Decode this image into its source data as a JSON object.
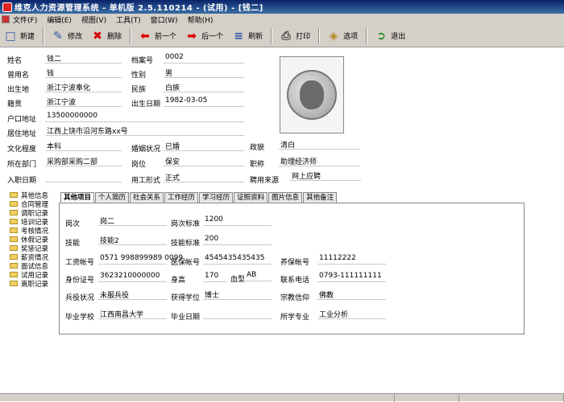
{
  "window": {
    "title": "维克人力资源管理系统 - 单机版 2.5.110214 - (试用) - [钱二]"
  },
  "menu": [
    "文件(F)",
    "编辑(E)",
    "视图(V)",
    "工具(T)",
    "窗口(W)",
    "帮助(H)"
  ],
  "toolbar": {
    "new": "新建",
    "edit": "修改",
    "delete": "删除",
    "prev": "前一个",
    "next": "后一个",
    "refresh": "刷新",
    "print": "打印",
    "options": "选项",
    "exit": "退出"
  },
  "form": {
    "name_l": "姓名",
    "name": "钱二",
    "fileno_l": "档案号",
    "fileno": "0002",
    "usedname_l": "曾用名",
    "usedname": "钱",
    "gender_l": "性别",
    "gender": "男",
    "birthplace_l": "出生地",
    "birthplace": "浙江宁波奉化",
    "ethnic_l": "民族",
    "ethnic": "白族",
    "native_l": "籍贯",
    "native": "浙江宁波",
    "birthdate_l": "出生日期",
    "birthdate": "1982-03-05",
    "hukou_l": "户口地址",
    "hukou": "13500000000",
    "address_l": "居住地址",
    "address": "江西上饶市沿河东路xx号",
    "edu_l": "文化程度",
    "edu": "本科",
    "marital_l": "婚姻状况",
    "marital": "已婚",
    "political_l": "政貌",
    "political": "清白",
    "dept_l": "所在部门",
    "dept": "采购部采购二部",
    "post_l": "岗位",
    "post": "保安",
    "title_l": "职称",
    "title": "助理经济师",
    "joindate_l": "入职日期",
    "joindate": "",
    "workform_l": "用工形式",
    "workform": "正式",
    "source_l": "聘用来源",
    "source": "网上应聘"
  },
  "tree": [
    "其他信息",
    "合同管理",
    "调职记录",
    "培训记录",
    "考核情况",
    "休假记录",
    "奖惩记录",
    "薪资情况",
    "面试信息",
    "试用记录",
    "离职记录"
  ],
  "tabs": [
    "其他项目",
    "个人简历",
    "社会关系",
    "工作经历",
    "学习经历",
    "证照资料",
    "图片信息",
    "其他备注"
  ],
  "detail": {
    "rank_l": "岗次",
    "rank": "岗二",
    "rankstd_l": "岗次标准",
    "rankstd": "1200",
    "skill_l": "技能",
    "skill": "技能2",
    "skillstd_l": "技能标准",
    "skillstd": "200",
    "wageacct_l": "工资帐号",
    "wageacct": "0571 998899989 0099",
    "medacct_l": "医保帐号",
    "medacct": "4545435435435",
    "ssacct_l": "养保帐号",
    "ssacct": "11112222",
    "idcard_l": "身份证号",
    "idcard": "3623210000000",
    "height_l": "身高",
    "height": "170",
    "blood_l": "血型",
    "blood": "AB",
    "phone_l": "联系电话",
    "phone": "0793-111111111",
    "military_l": "兵役状况",
    "military": "未服兵役",
    "degree_l": "获得学位",
    "degree": "博士",
    "religion_l": "宗教信仰",
    "religion": "佛教",
    "school_l": "毕业学校",
    "school": "江西南昌大学",
    "graddate_l": "毕业日期",
    "graddate": "",
    "major_l": "所学专业",
    "major": "工业分析"
  }
}
